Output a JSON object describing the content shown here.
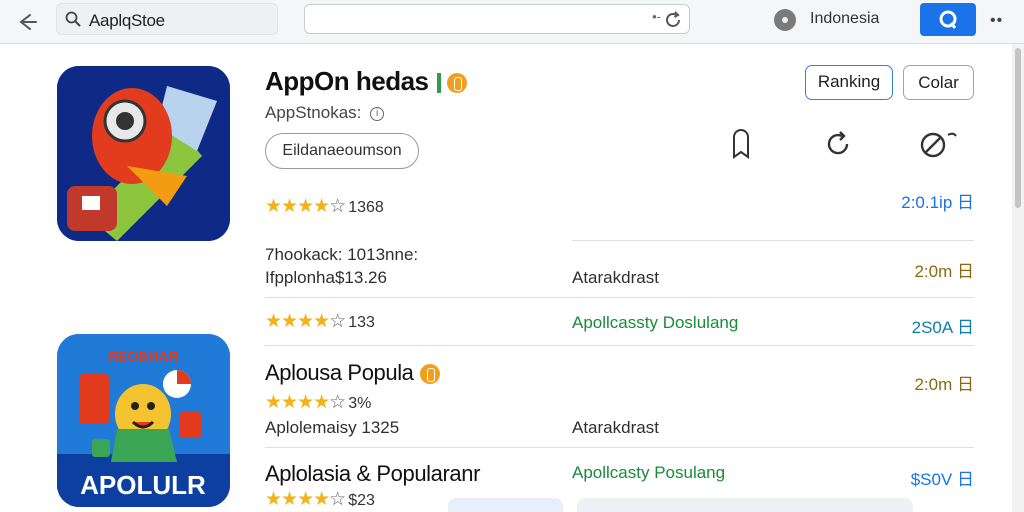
{
  "toolbar": {
    "search_text": "AaplqStoe",
    "country": "Indonesia"
  },
  "apps": [
    {
      "title": "AppOn hedas",
      "developer": "AppStnokas:",
      "category_pill": "Eildanaeoumson",
      "stars": "4",
      "rating_count": "1368",
      "right_value": "2:0.1ip 日",
      "extra_line1": "7hookack: 1013nne:",
      "extra_line2": "Ifpplonha$13.26",
      "extra_mid": "Atarakdrast",
      "extra_right": "2:0m 日"
    },
    {
      "title": "Aplousa Popula",
      "stars": "3.5",
      "rating_count": "3%",
      "developer": "Aplolemaisy 1325",
      "mid": "Atarakdrast",
      "right_value": "2:0m 日"
    },
    {
      "title": "Aplolasia & Popularanr",
      "stars": "4",
      "rating_count": "$23",
      "mid": "Apollcasty Posulang",
      "right_value": "$S0V 日"
    }
  ],
  "row_between": {
    "stars": "4",
    "rating_count": "133",
    "mid": "Apollcassty Doslulang",
    "right_value": "2S0A 日"
  },
  "buttons": {
    "ranking": "Ranking",
    "other": "Colar"
  },
  "icon_labels": {
    "app2_top": "ЯЕОВИАЯ",
    "app2_bottom": "APOLULR"
  },
  "colors": {
    "accent_blue": "#1a73e8",
    "star_gold": "#f2b21b",
    "green_text": "#1b8a3a"
  }
}
